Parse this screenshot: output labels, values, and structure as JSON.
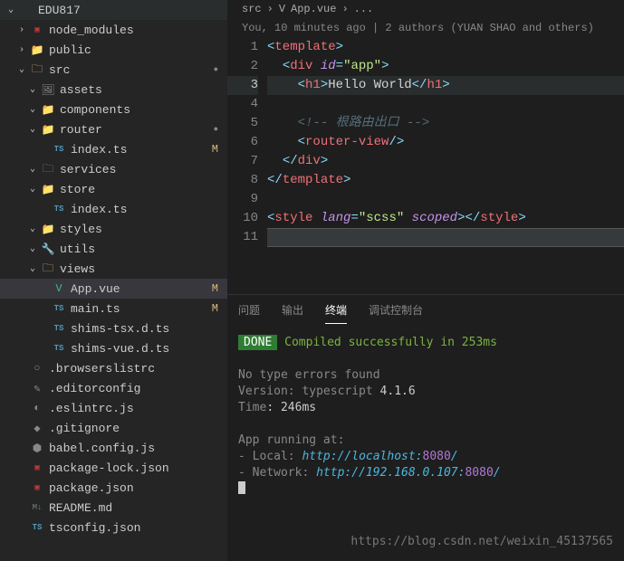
{
  "project_name": "EDU817",
  "tree": [
    {
      "indent": 0,
      "chev": "expanded",
      "icon": "",
      "iconClass": "project-title",
      "label": "EDU817",
      "labelClass": "project-title",
      "status": ""
    },
    {
      "indent": 1,
      "chev": "collapsed",
      "icon": "▣",
      "iconClass": "fi-npm",
      "label": "node_modules",
      "status": ""
    },
    {
      "indent": 1,
      "chev": "collapsed",
      "icon": "📁",
      "iconClass": "fi-pub",
      "label": "public",
      "status": ""
    },
    {
      "indent": 1,
      "chev": "expanded",
      "icon": "🗀",
      "iconClass": "fi-folder",
      "label": "src",
      "status": "",
      "dot": true
    },
    {
      "indent": 2,
      "chev": "expanded",
      "icon": "🖼",
      "iconClass": "fi-gen",
      "label": "assets",
      "status": ""
    },
    {
      "indent": 2,
      "chev": "expanded",
      "icon": "📁",
      "iconClass": "fi-folder",
      "label": "components",
      "status": ""
    },
    {
      "indent": 2,
      "chev": "expanded",
      "icon": "📁",
      "iconClass": "fi-folder",
      "label": "router",
      "status": "",
      "dot": true
    },
    {
      "indent": 3,
      "chev": "none",
      "icon": "TS",
      "iconClass": "fi-ts",
      "label": "index.ts",
      "status": "M"
    },
    {
      "indent": 2,
      "chev": "expanded",
      "icon": "🗀",
      "iconClass": "fi-gen",
      "label": "services",
      "status": ""
    },
    {
      "indent": 2,
      "chev": "expanded",
      "icon": "📁",
      "iconClass": "fi-folder",
      "label": "store",
      "status": ""
    },
    {
      "indent": 3,
      "chev": "none",
      "icon": "TS",
      "iconClass": "fi-ts",
      "label": "index.ts",
      "status": ""
    },
    {
      "indent": 2,
      "chev": "expanded",
      "icon": "📁",
      "iconClass": "fi-folder",
      "label": "styles",
      "status": ""
    },
    {
      "indent": 2,
      "chev": "expanded",
      "icon": "🔧",
      "iconClass": "fi-gen",
      "label": "utils",
      "status": ""
    },
    {
      "indent": 2,
      "chev": "expanded",
      "icon": "🗀",
      "iconClass": "fi-folder",
      "label": "views",
      "status": ""
    },
    {
      "indent": 3,
      "chev": "none",
      "icon": "V",
      "iconClass": "fi-vue",
      "label": "App.vue",
      "status": "M",
      "selected": true
    },
    {
      "indent": 3,
      "chev": "none",
      "icon": "TS",
      "iconClass": "fi-ts",
      "label": "main.ts",
      "status": "M"
    },
    {
      "indent": 3,
      "chev": "none",
      "icon": "TS",
      "iconClass": "fi-ts",
      "label": "shims-tsx.d.ts",
      "status": ""
    },
    {
      "indent": 3,
      "chev": "none",
      "icon": "TS",
      "iconClass": "fi-ts",
      "label": "shims-vue.d.ts",
      "status": ""
    },
    {
      "indent": 1,
      "chev": "none",
      "icon": "○",
      "iconClass": "fi-gen",
      "label": ".browserslistrc",
      "status": ""
    },
    {
      "indent": 1,
      "chev": "none",
      "icon": "✎",
      "iconClass": "fi-gen",
      "label": ".editorconfig",
      "status": ""
    },
    {
      "indent": 1,
      "chev": "none",
      "icon": "◐",
      "iconClass": "fi-gen",
      "label": ".eslintrc.js",
      "status": ""
    },
    {
      "indent": 1,
      "chev": "none",
      "icon": "◆",
      "iconClass": "fi-gen",
      "label": ".gitignore",
      "status": ""
    },
    {
      "indent": 1,
      "chev": "none",
      "icon": "⬢",
      "iconClass": "fi-gen",
      "label": "babel.config.js",
      "status": ""
    },
    {
      "indent": 1,
      "chev": "none",
      "icon": "▣",
      "iconClass": "fi-npm",
      "label": "package-lock.json",
      "status": ""
    },
    {
      "indent": 1,
      "chev": "none",
      "icon": "▣",
      "iconClass": "fi-npm",
      "label": "package.json",
      "status": ""
    },
    {
      "indent": 1,
      "chev": "none",
      "icon": "M↓",
      "iconClass": "fi-md",
      "label": "README.md",
      "status": ""
    },
    {
      "indent": 1,
      "chev": "none",
      "icon": "TS",
      "iconClass": "fi-ts",
      "label": "tsconfig.json",
      "status": ""
    }
  ],
  "breadcrumb": {
    "root": "src",
    "file": "App.vue",
    "sep": "›",
    "more": "..."
  },
  "authors": "You, 10 minutes ago | 2 authors (YUAN SHAO and others)",
  "code": {
    "lines": [
      {
        "n": 1,
        "html": "<span class='t-bracket'>&lt;</span><span class='t-tag'>template</span><span class='t-bracket'>&gt;</span>"
      },
      {
        "n": 2,
        "html": "  <span class='t-bracket'>&lt;</span><span class='t-tag'>div</span> <span class='t-attr'>id</span><span class='t-bracket'>=</span><span class='t-str'>\"app\"</span><span class='t-bracket'>&gt;</span>"
      },
      {
        "n": 3,
        "html": "    <span class='t-bracket'>&lt;</span><span class='t-tag'>h1</span><span class='t-bracket'>&gt;</span><span class='t-text'>Hello World</span><span class='t-bracket'>&lt;/</span><span class='t-tag'>h1</span><span class='t-bracket'>&gt;</span>",
        "active": true
      },
      {
        "n": 4,
        "html": ""
      },
      {
        "n": 5,
        "html": "    <span class='t-comment'>&lt;!-- 根路由出口 --&gt;</span>"
      },
      {
        "n": 6,
        "html": "    <span class='t-bracket'>&lt;</span><span class='t-tag'>router-view</span><span class='t-bracket'>/&gt;</span>"
      },
      {
        "n": 7,
        "html": "  <span class='t-bracket'>&lt;/</span><span class='t-tag'>div</span><span class='t-bracket'>&gt;</span>"
      },
      {
        "n": 8,
        "html": "<span class='t-bracket'>&lt;/</span><span class='t-tag'>template</span><span class='t-bracket'>&gt;</span>"
      },
      {
        "n": 9,
        "html": ""
      },
      {
        "n": 10,
        "html": "<span class='t-bracket'>&lt;</span><span class='t-tag'>style</span> <span class='t-attr'>lang</span><span class='t-bracket'>=</span><span class='t-str'>\"scss\"</span> <span class='t-attr'>scoped</span><span class='t-bracket'>&gt;&lt;/</span><span class='t-tag'>style</span><span class='t-bracket'>&gt;</span>"
      },
      {
        "n": 11,
        "html": "",
        "hl": true
      }
    ]
  },
  "terminal": {
    "tabs": [
      "问题",
      "输出",
      "终端",
      "调试控制台"
    ],
    "active_tab": 2,
    "done_label": "DONE",
    "compiled": "Compiled successfully in 253ms",
    "no_errors": "No type errors found",
    "version_label": "Version: typescript",
    "version": "4.1.6",
    "time_label": "Time:",
    "time": "246ms",
    "running": "App running at:",
    "local_label": "- Local:   ",
    "local_url": "http://localhost:",
    "local_port": "8080",
    "local_slash": "/",
    "network_label": "- Network: ",
    "network_url": "http://192.168.0.107:",
    "network_port": "8080",
    "network_slash": "/"
  },
  "watermark": "https://blog.csdn.net/weixin_45137565"
}
